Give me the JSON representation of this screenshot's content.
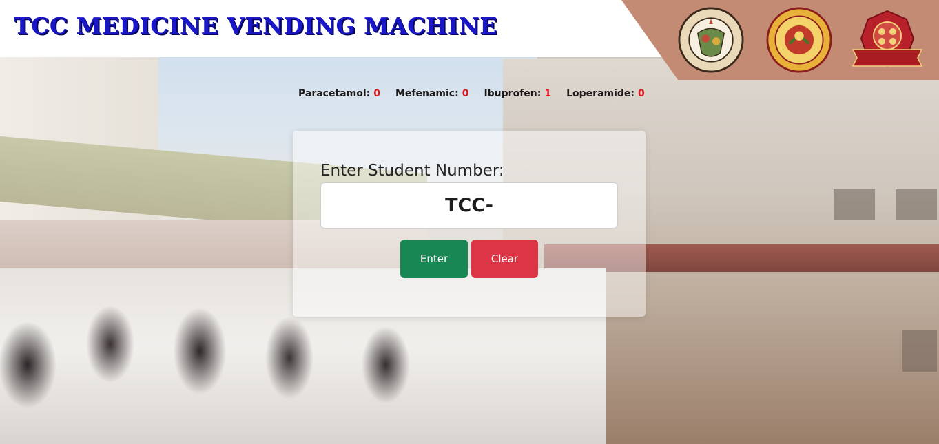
{
  "header": {
    "title": "TCC MEDICINE VENDING MACHINE",
    "logos": [
      {
        "name": "Lungsod ng Tanauan seal",
        "ring_text": "LUNGSOD NG TANAUAN · LALAWIGAN NG BATANGAS"
      },
      {
        "name": "Tanauan City College seal",
        "ring_text": "TANAUAN CITY COLLEGE"
      },
      {
        "name": "ACCESS emblem",
        "ring_text": "ACCESS"
      }
    ]
  },
  "stock": [
    {
      "label": "Paracetamol:",
      "count": "0"
    },
    {
      "label": "Mefenamic:",
      "count": "0"
    },
    {
      "label": "Ibuprofen:",
      "count": "1"
    },
    {
      "label": "Loperamide:",
      "count": "0"
    }
  ],
  "form": {
    "label": "Enter Student Number:",
    "input_value": "TCC-",
    "enter_label": "Enter",
    "clear_label": "Clear"
  },
  "colors": {
    "title": "#1a17c9",
    "logo_panel": "#c48b74",
    "count": "#e0151b",
    "enter_button": "#198754",
    "clear_button": "#dc3545"
  }
}
